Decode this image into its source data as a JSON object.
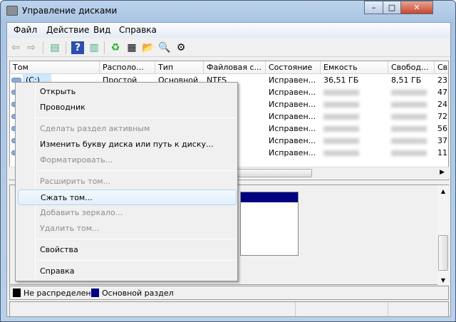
{
  "window": {
    "title": "Управление дисками",
    "minimize": "–",
    "maximize": "□",
    "close": "✕"
  },
  "menubar": [
    "Файл",
    "Действие",
    "Вид",
    "Справка"
  ],
  "toolbar": [
    "back-icon",
    "forward-icon",
    "show-hide-console-tree-icon",
    "help-icon",
    "show-action-pane-icon",
    "refresh-icon",
    "properties-icon",
    "open-icon",
    "explore-icon",
    "settings-icon"
  ],
  "columns": [
    "Том",
    "Располо...",
    "Тип",
    "Файловая с...",
    "Состояние",
    "Емкость",
    "Свобод...",
    "Св"
  ],
  "rows": [
    {
      "volume": "(C:)",
      "layout": "Простой",
      "type": "Основной",
      "fs": "NTFS",
      "status": "Исправен...",
      "capacity": "36,51 ГБ",
      "free": "8,51 ГБ",
      "pct": "23"
    },
    {
      "status": "Исправен...",
      "pct": "47"
    },
    {
      "status": "Исправен...",
      "pct": "24"
    },
    {
      "status": "Исправен...",
      "pct": "72"
    },
    {
      "status": "Исправен...",
      "pct": "56"
    },
    {
      "status": "Исправен...",
      "pct": "37"
    },
    {
      "status": "Исправен...",
      "pct": "11"
    }
  ],
  "context_menu": [
    {
      "label": "Открыть",
      "disabled": false
    },
    {
      "label": "Проводник",
      "disabled": false
    },
    {
      "sep": true
    },
    {
      "label": "Сделать раздел активным",
      "disabled": true
    },
    {
      "label": "Изменить букву диска или путь к диску...",
      "disabled": false
    },
    {
      "label": "Форматировать...",
      "disabled": true
    },
    {
      "sep": true
    },
    {
      "label": "Расширить том...",
      "disabled": true
    },
    {
      "label": "Сжать том...",
      "disabled": false,
      "hover": true
    },
    {
      "label": "Добавить зеркало...",
      "disabled": true
    },
    {
      "label": "Удалить том...",
      "disabled": true
    },
    {
      "sep": true
    },
    {
      "label": "Свойства",
      "disabled": false
    },
    {
      "sep": true
    },
    {
      "label": "Справка",
      "disabled": false
    }
  ],
  "legend": [
    {
      "label": "Не распределен",
      "color": "#000000"
    },
    {
      "label": "Основной раздел",
      "color": "#000080"
    }
  ]
}
